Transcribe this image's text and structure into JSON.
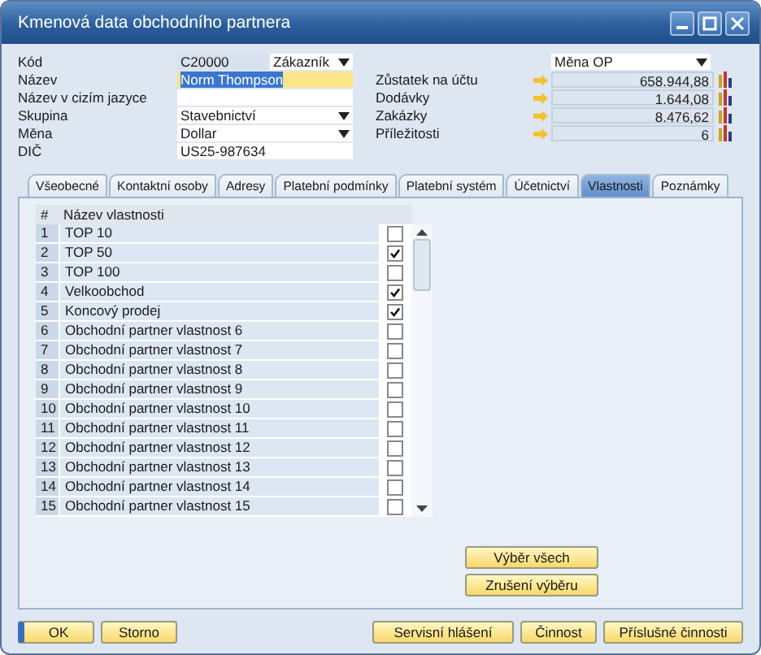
{
  "window": {
    "title": "Kmenová data obchodního partnera"
  },
  "left_fields": [
    {
      "label": "Kód",
      "kind": "code",
      "value": "C20000",
      "type_value": "Zákazník"
    },
    {
      "label": "Název",
      "kind": "text",
      "value": "Norm Thompson",
      "focused": true
    },
    {
      "label": "Název v cizím jazyce",
      "kind": "text",
      "focused": false
    },
    {
      "label": "Skupina",
      "kind": "select",
      "value": "Stavebnictví"
    },
    {
      "label": "Měna",
      "kind": "select",
      "value": "Dollar"
    },
    {
      "label": "DIČ",
      "kind": "text",
      "value": "US25-987634",
      "focused": false
    }
  ],
  "currency_select": {
    "value": "Měna OP"
  },
  "balances": [
    {
      "label": "Zůstatek na účtu",
      "value": "658.944,88"
    },
    {
      "label": "Dodávky",
      "value": "1.644,08"
    },
    {
      "label": "Zakázky",
      "value": "8.476,62"
    },
    {
      "label": "Příležitosti",
      "value": "6"
    }
  ],
  "tabs": [
    {
      "label": "Všeobecné",
      "selected": false
    },
    {
      "label": "Kontaktní osoby",
      "selected": false
    },
    {
      "label": "Adresy",
      "selected": false
    },
    {
      "label": "Platební podmínky",
      "selected": false
    },
    {
      "label": "Platební systém",
      "selected": false
    },
    {
      "label": "Účetnictví",
      "selected": false
    },
    {
      "label": "Vlastnosti",
      "selected": true
    },
    {
      "label": "Poznámky",
      "selected": false
    }
  ],
  "properties": {
    "columns": [
      "#",
      "Název vlastnosti"
    ],
    "rows": [
      {
        "number": "1",
        "name": "TOP 10",
        "checked": false
      },
      {
        "number": "2",
        "name": "TOP 50",
        "checked": true
      },
      {
        "number": "3",
        "name": "TOP 100",
        "checked": false
      },
      {
        "number": "4",
        "name": "Velkoobchod",
        "checked": true
      },
      {
        "number": "5",
        "name": "Koncový prodej",
        "checked": true
      },
      {
        "number": "6",
        "name": "Obchodní partner vlastnost 6",
        "checked": false
      },
      {
        "number": "7",
        "name": "Obchodní partner vlastnost 7",
        "checked": false
      },
      {
        "number": "8",
        "name": "Obchodní partner vlastnost 8",
        "checked": false
      },
      {
        "number": "9",
        "name": "Obchodní partner vlastnost 9",
        "checked": false
      },
      {
        "number": "10",
        "name": "Obchodní partner vlastnost 10",
        "checked": false
      },
      {
        "number": "11",
        "name": "Obchodní partner vlastnost 11",
        "checked": false
      },
      {
        "number": "12",
        "name": "Obchodní partner vlastnost 12",
        "checked": false
      },
      {
        "number": "13",
        "name": "Obchodní partner vlastnost 13",
        "checked": false
      },
      {
        "number": "14",
        "name": "Obchodní partner vlastnost 14",
        "checked": false
      },
      {
        "number": "15",
        "name": "Obchodní partner vlastnost 15",
        "checked": false
      }
    ]
  },
  "side_buttons": [
    "Výběr všech",
    "Zrušení výběru"
  ],
  "footer_left": [
    {
      "label": "OK",
      "default": true
    },
    {
      "label": "Storno",
      "default": false
    }
  ],
  "footer_right": [
    {
      "label": "Servisní hlášení",
      "default": false
    },
    {
      "label": "Činnost",
      "default": false
    },
    {
      "label": "Příslušné činnosti",
      "default": false
    }
  ]
}
